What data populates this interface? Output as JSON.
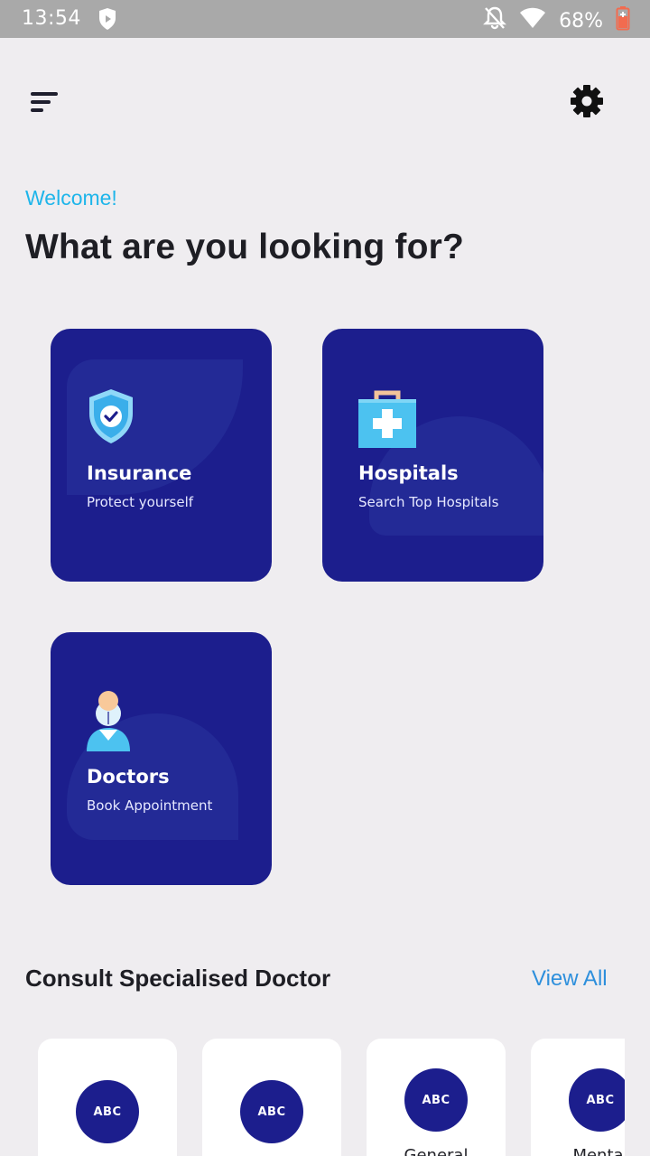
{
  "status_bar": {
    "time": "13:54",
    "battery_percent": "68%",
    "icons": [
      "shield-icon",
      "notifications-off-icon",
      "wifi-icon",
      "battery-charging-icon"
    ]
  },
  "app_bar": {
    "menu_icon": "menu-icon",
    "settings_icon": "gear-icon"
  },
  "greeting": {
    "welcome": "Welcome!",
    "headline": "What are you looking for?"
  },
  "categories": [
    {
      "title": "Insurance",
      "subtitle": "Protect yourself",
      "icon": "shield-check-icon"
    },
    {
      "title": "Hospitals",
      "subtitle": "Search Top Hospitals",
      "icon": "medical-kit-icon"
    },
    {
      "title": "Doctors",
      "subtitle": "Book Appointment",
      "icon": "doctor-icon"
    }
  ],
  "specialists": {
    "title": "Consult Specialised Doctor",
    "view_all": "View All",
    "items": [
      {
        "badge": "ABC",
        "label": ""
      },
      {
        "badge": "ABC",
        "label": ""
      },
      {
        "badge": "ABC",
        "label": "General"
      },
      {
        "badge": "ABC",
        "label": "Mental"
      }
    ]
  },
  "colors": {
    "accent_cyan": "#1eb5ea",
    "card_navy": "#1c1e8d",
    "link_blue": "#2d8fdc",
    "background": "#efedf0"
  }
}
